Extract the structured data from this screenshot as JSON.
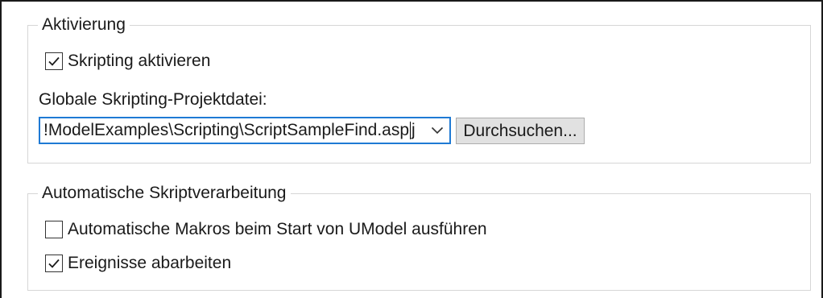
{
  "activation": {
    "title": "Aktivierung",
    "enable_scripting": {
      "label": "Skripting aktivieren",
      "checked": true
    },
    "project_file_label": "Globale Skripting-Projektdatei:",
    "project_file_value_before_caret": "!ModelExamples\\Scripting\\ScriptSampleFind.asp",
    "project_file_value_after_caret": "j",
    "browse_button": "Durchsuchen..."
  },
  "auto_processing": {
    "title": "Automatische Skriptverarbeitung",
    "auto_macros": {
      "label": "Automatische Makros beim Start von UModel ausführen",
      "checked": false
    },
    "process_events": {
      "label": "Ereignisse abarbeiten",
      "checked": true
    }
  },
  "colors": {
    "focus_border": "#1f7ad4",
    "group_border": "#d6d6d6",
    "button_bg": "#e1e1e1"
  },
  "icons": {
    "checkmark": "checkmark-icon",
    "dropdown": "chevron-down-icon"
  }
}
